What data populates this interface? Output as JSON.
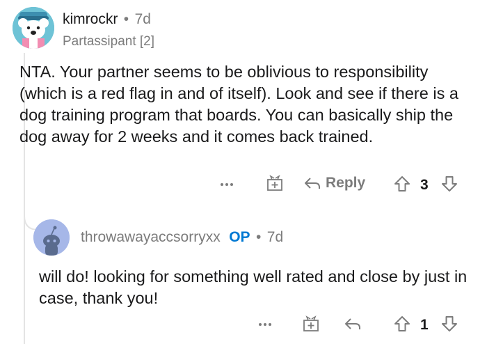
{
  "comment": {
    "username": "kimrockr",
    "separator": "•",
    "age": "7d",
    "flair": "Partassipant [2]",
    "body": "NTA. Your partner seems to be oblivious to responsibility (which is a red flag in and of itself). Look and see if there is a dog training program that boards. You can basically ship the dog away for 2 weeks and it comes back trained.",
    "actions": {
      "more": "more-icon",
      "award": "gift-icon",
      "reply_label": "Reply",
      "score": "3"
    }
  },
  "reply": {
    "username": "throwawayaccsorryxx",
    "op_badge": "OP",
    "separator": "•",
    "age": "7d",
    "body": "will do! looking for something well rated and close by just in case, thank you!",
    "actions": {
      "more": "more-icon",
      "award": "gift-icon",
      "score": "1"
    }
  },
  "colors": {
    "op": "#0079d3",
    "meta": "#7c7c7c",
    "text": "#1a1a1b",
    "thread_line": "#e4e4e4"
  }
}
